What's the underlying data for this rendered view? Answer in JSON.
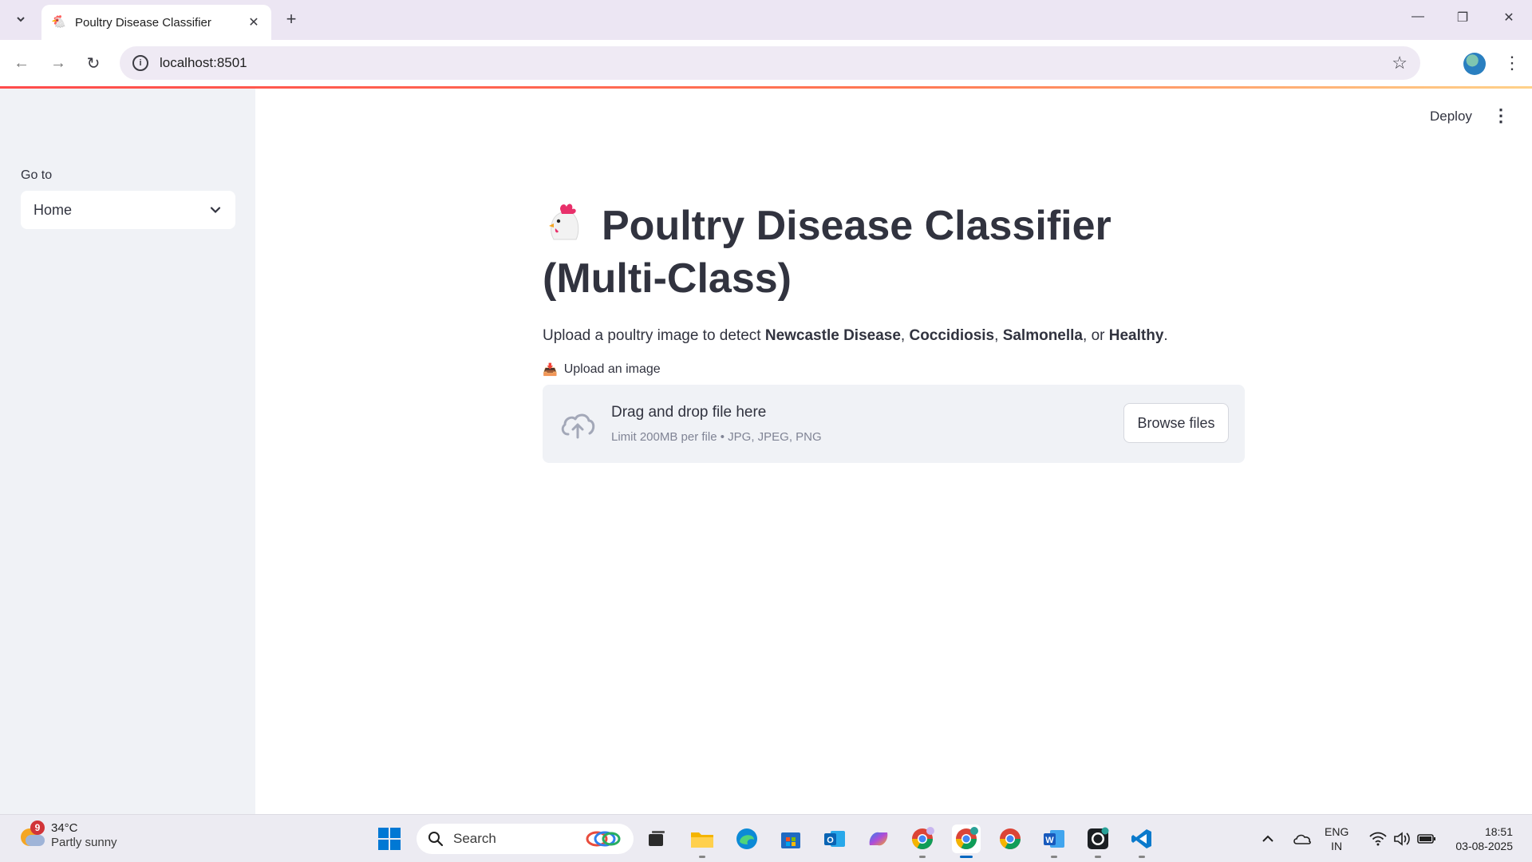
{
  "browser": {
    "tab_title": "Poultry Disease Classifier",
    "url": "localhost:8501"
  },
  "sidebar": {
    "nav_label": "Go to",
    "nav_selected": "Home"
  },
  "header": {
    "deploy_label": "Deploy"
  },
  "main": {
    "title": "Poultry Disease Classifier (Multi-Class)",
    "subtitle_prefix": "Upload a poultry image to detect ",
    "diseases": [
      "Newcastle Disease",
      "Coccidiosis",
      "Salmonella",
      "Healthy"
    ],
    "upload_label": "Upload an image",
    "dropzone_main": "Drag and drop file here",
    "dropzone_sub": "Limit 200MB per file • JPG, JPEG, PNG",
    "browse_label": "Browse files"
  },
  "taskbar": {
    "weather_badge": "9",
    "weather_temp": "34°C",
    "weather_desc": "Partly sunny",
    "search_label": "Search",
    "lang_top": "ENG",
    "lang_bottom": "IN",
    "time": "18:51",
    "date": "03-08-2025"
  },
  "colors": {
    "accent": "#ff4b4b",
    "sidebar_bg": "#f0f2f6",
    "text": "#31333f"
  }
}
